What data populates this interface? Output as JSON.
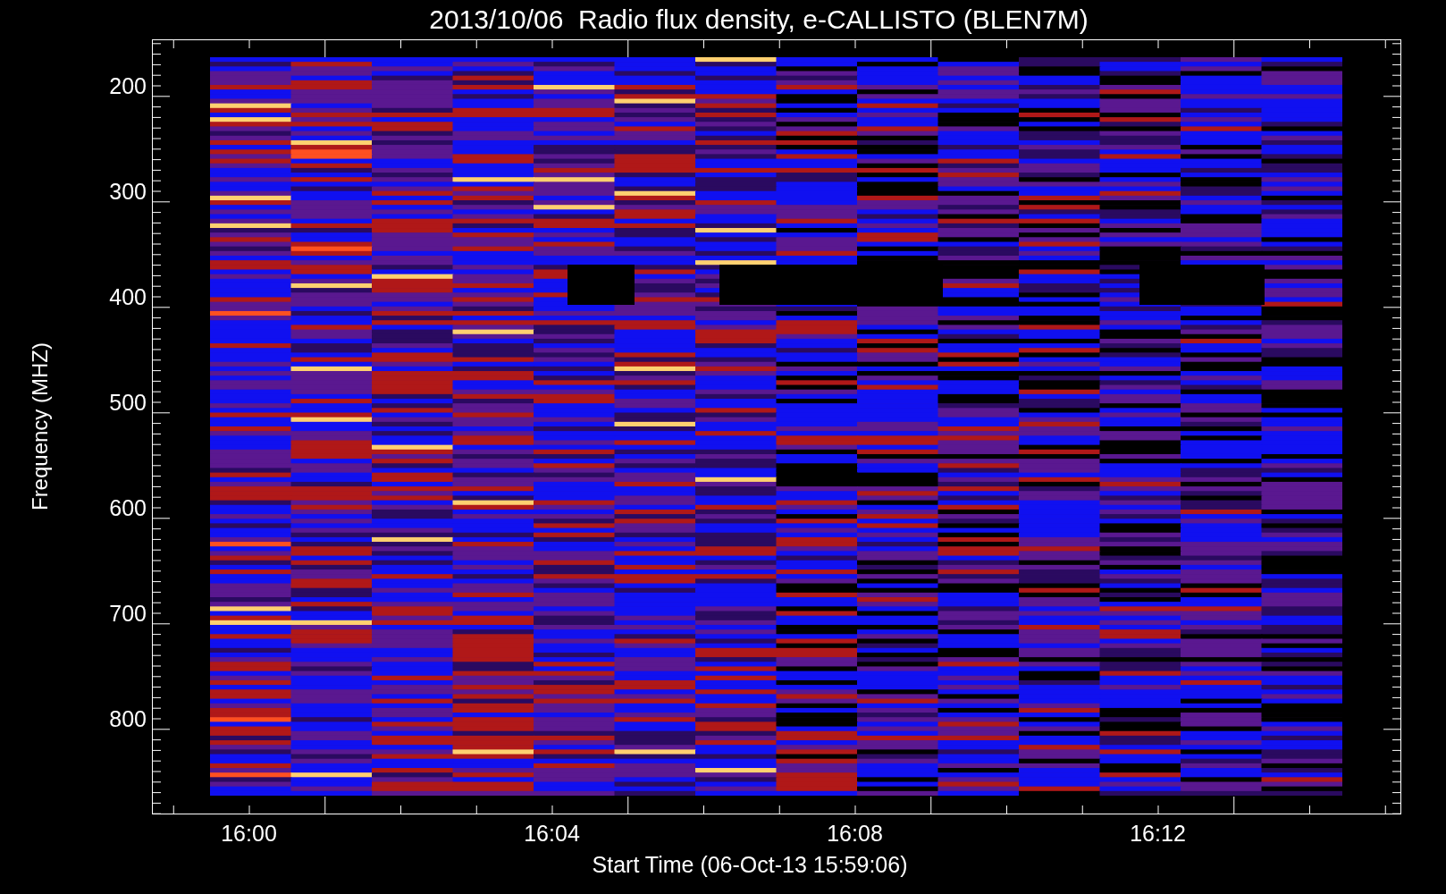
{
  "title": "2013/10/06  Radio flux density, e-CALLISTO (BLEN7M)",
  "y_axis": {
    "label": "Frequency (MHZ)",
    "ticks": [
      "200",
      "300",
      "400",
      "500",
      "600",
      "700",
      "800"
    ]
  },
  "x_axis": {
    "label": "Start Time (06-Oct-13 15:59:06)",
    "ticks": [
      "16:00",
      "16:04",
      "16:08",
      "16:12"
    ]
  }
}
